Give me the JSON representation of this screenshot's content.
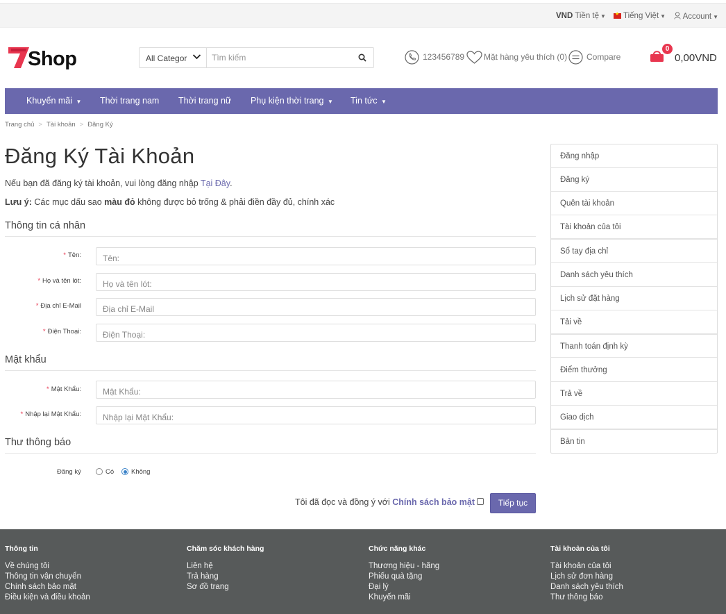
{
  "topbar": {
    "currency_code": "VND",
    "currency_label": "Tiền tệ",
    "language_label": "Tiếng Việt",
    "account_label": "Account"
  },
  "header": {
    "logo_text": "Shop",
    "logo_mark": "7",
    "search_category": "All Categor",
    "search_placeholder": "Tìm kiếm",
    "phone": "123456789",
    "wishlist": "Mặt hàng yêu thích (0)",
    "compare": "Compare",
    "cart_count": "0",
    "cart_total": "0,00VND",
    "brand_color": "#6a68ad",
    "accent_color": "#e8364f"
  },
  "menu": [
    {
      "label": "Khuyến mãi",
      "dropdown": true
    },
    {
      "label": "Thời trang nam",
      "dropdown": false
    },
    {
      "label": "Thời trang nữ",
      "dropdown": false
    },
    {
      "label": "Phụ kiện thời trang",
      "dropdown": true
    },
    {
      "label": "Tin tức",
      "dropdown": true
    }
  ],
  "breadcrumb": [
    "Trang chủ",
    "Tài khoản",
    "Đăng Ký"
  ],
  "page": {
    "title": "Đăng Ký Tài Khoản",
    "intro_text": "Nếu bạn đã đăng ký tài khoản, vui lòng đăng nhập ",
    "intro_link": "Tại Đây",
    "intro_end": ".",
    "note_label": "Lưu ý:",
    "note_text_1": " Các mục dấu sao ",
    "note_bold": "màu đỏ",
    "note_text_2": " không được bỏ trống & phải điền đầy đủ, chính xác"
  },
  "sections": {
    "personal": "Thông tin cá nhân",
    "password": "Mật khẩu",
    "newsletter": "Thư thông báo"
  },
  "fields": {
    "firstname": {
      "label": "Tên:",
      "placeholder": "Tên:"
    },
    "lastname": {
      "label": "Họ và tên lót:",
      "placeholder": "Họ và tên lót:"
    },
    "email": {
      "label": "Địa chỉ E-Mail",
      "placeholder": "Địa chỉ E-Mail"
    },
    "phone": {
      "label": "Điện Thoại:",
      "placeholder": "Điện Thoại:"
    },
    "password": {
      "label": "Mật Khẩu:",
      "placeholder": "Mật Khẩu:"
    },
    "confirm": {
      "label": "Nhập lại Mật Khẩu:",
      "placeholder": "Nhập lại Mật Khẩu:"
    }
  },
  "newsletter": {
    "label": "Đăng ký",
    "yes": "Có",
    "no": "Không",
    "selected": "Không"
  },
  "agree": {
    "text": "Tôi đã đọc và đồng ý với ",
    "link": "Chính sách bảo mật",
    "button": "Tiếp tục"
  },
  "sidebar": [
    "Đăng nhập",
    "Đăng ký",
    "Quên tài khoản",
    "Tài khoản của tôi",
    "Sổ tay địa chỉ",
    "Danh sách yêu thích",
    "Lịch sử đặt hàng",
    "Tải về",
    "Thanh toán định kỳ",
    "Điểm thưởng",
    "Trả về",
    "Giao dịch",
    "Bản tin"
  ],
  "footer": [
    {
      "title": "Thông tin",
      "links": [
        "Về chúng tôi",
        "Thông tin vận chuyển",
        "Chính sách bảo mật",
        "Điều kiện và điều khoản"
      ]
    },
    {
      "title": "Chăm sóc khách hàng",
      "links": [
        "Liên hệ",
        "Trả hàng",
        "Sơ đồ trang"
      ]
    },
    {
      "title": "Chức năng khác",
      "links": [
        "Thương hiệu - hãng",
        "Phiếu quà tặng",
        "Đại lý",
        "Khuyến mãi"
      ]
    },
    {
      "title": "Tài khoản của tôi",
      "links": [
        "Tài khoản của tôi",
        "Lịch sử đơn hàng",
        "Danh sách yêu thích",
        "Thư thông báo"
      ]
    }
  ]
}
